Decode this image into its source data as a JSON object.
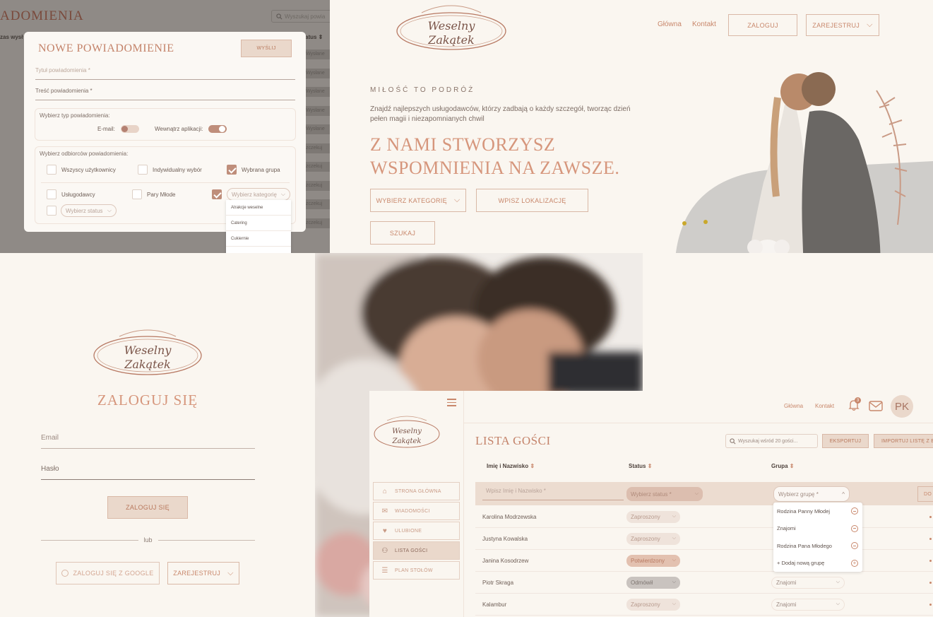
{
  "brand": {
    "logo_line1": "Weselny",
    "logo_line2": "Zakątek"
  },
  "notify": {
    "page_title": "ADOMIENIA",
    "search_placeholder": "Wyszukaj powia",
    "bg_col1": "zas wysł",
    "bg_col2": "atus",
    "bg_statuses": [
      "Wysłane",
      "Wysłane",
      "Wysłane",
      "Wysłane",
      "Wysłane",
      "zczekuj",
      "zczekuj",
      "zczekuj",
      "zczekuj",
      "zczekuj"
    ],
    "modal_title": "NOWE POWIADOMIENIE",
    "send_label": "WYŚLIJ",
    "title_placeholder": "Tytuł powiadomienia *",
    "content_placeholder": "Treść powiadomienia *",
    "type_label": "Wybierz typ powiadomienia:",
    "email_label": "E-mail:",
    "inapp_label": "Wewnątrz aplikacji:",
    "recipients_label": "Wybierz odbiorców powiadomienia:",
    "opt_all": "Wszyscy użytkownicy",
    "opt_individual": "Indywidualny wybór",
    "opt_group": "Wybrana grupa",
    "opt_vendors": "Usługodawcy",
    "opt_couples": "Pary Młode",
    "category_placeholder": "Wybierz kategorię",
    "status_placeholder": "Wybierz status",
    "category_options": [
      "Atrakcje weselne",
      "Catering",
      "Cukiernie"
    ]
  },
  "home": {
    "nav_home": "Główna",
    "nav_contact": "Kontakt",
    "login": "ZALOGUJ",
    "register": "ZAREJESTRUJ",
    "tagline": "MIŁOŚĆ TO PODRÓŻ",
    "lead": "Znajdź najlepszych usługodawców, którzy zadbają o każdy szczegół, tworząc dzień pełen magii i niezapomnianych chwil",
    "headline1": "Z NAMI STWORZYSZ",
    "headline2": "WSPOMNIENIA NA ZAWSZE.",
    "category_btn": "WYBIERZ KATEGORIĘ",
    "location_btn": "WPISZ LOKALIZACJĘ",
    "search_btn": "SZUKAJ"
  },
  "login": {
    "title": "ZALOGUJ SIĘ",
    "email_placeholder": "Email",
    "password_placeholder": "Hasło",
    "submit": "ZALOGUJ SIĘ",
    "or": "lub",
    "google": "ZALOGUJ SIĘ Z GOOGLE",
    "register": "ZAREJESTRUJ"
  },
  "guests": {
    "nav_home": "Główna",
    "nav_contact": "Kontakt",
    "notif_count": "3",
    "avatar": "PK",
    "title": "LISTA GOŚCI",
    "search_placeholder": "Wyszukaj wśród 20 gości...",
    "export_btn": "EKSPORTUJ",
    "import_btn": "IMPORTUJ LISTĘ Z E",
    "col_name": "Imię i Nazwisko",
    "col_status": "Status",
    "col_group": "Grupa",
    "name_placeholder": "Wpisz Imię i Nazwisko *",
    "status_placeholder": "Wybierz status *",
    "group_placeholder": "Wybierz grupę *",
    "add_btn": "DO",
    "group_options": [
      "Rodzina Panny Młodej",
      "Znajomi",
      "Rodzina Pana Młodego"
    ],
    "add_group": "+ Dodaj nową grupę",
    "sidebar": [
      "STRONA GŁÓWNA",
      "WIADOMOŚCI",
      "ULUBIONE",
      "LISTA GOŚCI",
      "PLAN STOŁÓW"
    ],
    "rows": [
      {
        "name": "Karolina Modrzewska",
        "status": "Zaproszony",
        "group": ""
      },
      {
        "name": "Justyna Kowalska",
        "status": "Zaproszony",
        "group": ""
      },
      {
        "name": "Janina Kosodrzew",
        "status": "Potwierdzony",
        "group": ""
      },
      {
        "name": "Piotr Skraga",
        "status": "Odmówił",
        "group": "Znajomi"
      },
      {
        "name": "Kalambur",
        "status": "Zaproszony",
        "group": "Znajomi"
      }
    ]
  },
  "colors": {
    "accent": "#c8876b",
    "bg": "#faf6f0",
    "pill_fill": "#ead8cb",
    "checkbox": "#bf8e7b"
  }
}
